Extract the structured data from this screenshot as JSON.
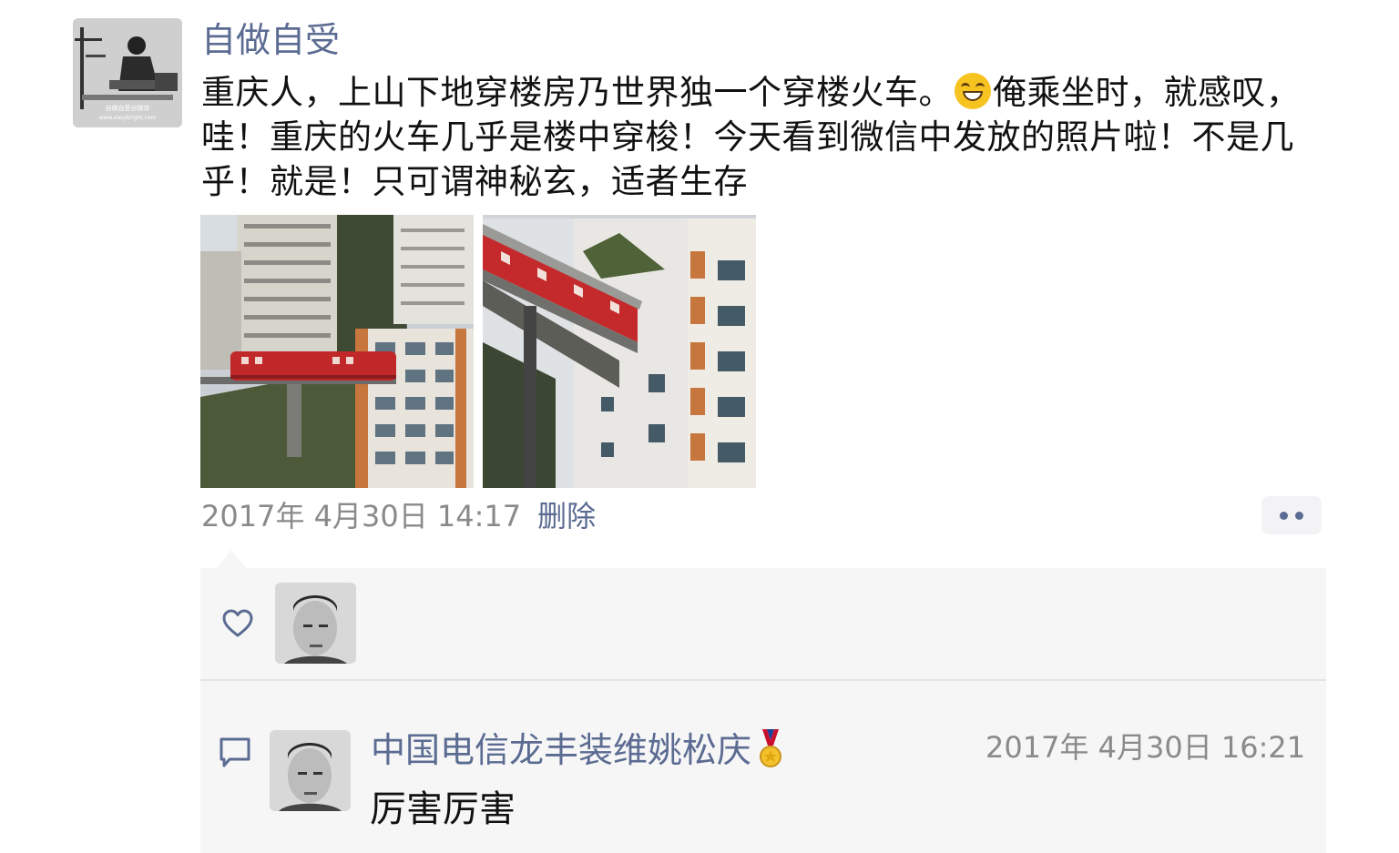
{
  "post": {
    "author": "自做自受",
    "text_part1": "重庆人，上山下地穿楼房乃世界独一个穿楼火车。",
    "emoji": "grinning-face-emoji",
    "text_part2": "俺乘坐时，就感叹，哇！重庆的火车几乎是楼中穿梭！今天看到微信中发放的照片啦！不是几乎！就是！只可谓神秘玄，适者生存",
    "avatar_watermark": "自做自受自媒体",
    "avatar_watermark_url": "www.easybright.com",
    "timestamp": "2017年 4月30日 14:17",
    "delete_label": "删除",
    "photos": [
      "train-through-building-photo-1",
      "train-through-building-photo-2"
    ]
  },
  "likes": {
    "icon": "heart-outline-icon",
    "users": [
      "liker-avatar"
    ]
  },
  "comments": [
    {
      "author": "中国电信龙丰装维姚松庆",
      "badge": "medal-icon",
      "time": "2017年 4月30日 16:21",
      "text": "厉害厉害"
    }
  ],
  "colors": {
    "link": "#5b6b92",
    "meta": "#8a8a8a",
    "panel": "#f6f6f6",
    "text": "#111111"
  }
}
